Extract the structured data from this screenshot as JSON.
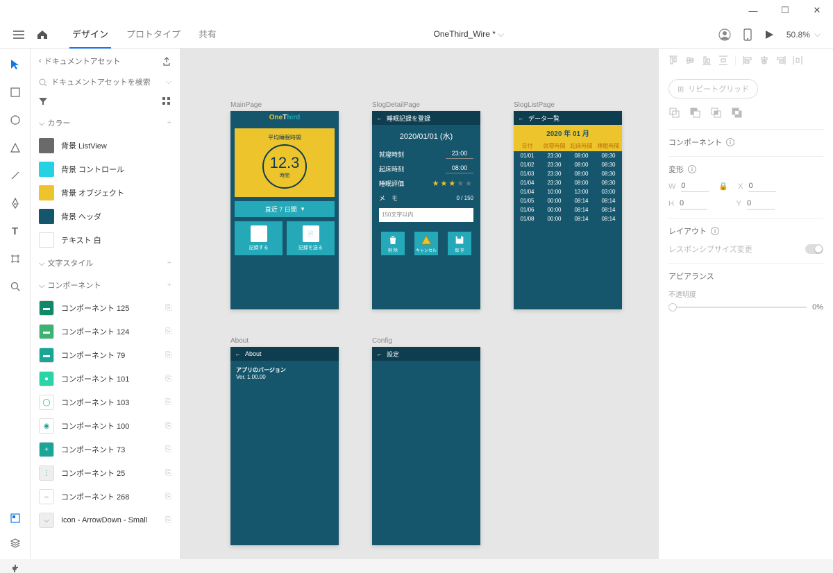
{
  "window": {
    "title": "OneThird_Wire *"
  },
  "toolbar": {
    "tabs": [
      "デザイン",
      "プロトタイプ",
      "共有"
    ],
    "zoom": "50.8%"
  },
  "assets": {
    "back": "ドキュメントアセット",
    "search_placeholder": "ドキュメントアセットを検索",
    "sections": {
      "colors": "カラー",
      "text": "文字スタイル",
      "components": "コンポーネント"
    },
    "colors": [
      {
        "hex": "#6a6a6a",
        "label": "背景 ListView"
      },
      {
        "hex": "#25d2e2",
        "label": "背景 コントロール"
      },
      {
        "hex": "#eec42d",
        "label": "背景 オブジェクト"
      },
      {
        "hex": "#16566c",
        "label": "背景 ヘッダ"
      },
      {
        "hex": "#ffffff",
        "label": "テキスト 白"
      }
    ],
    "components": [
      {
        "bg": "#0e8a6a",
        "label": "コンポーネント 125"
      },
      {
        "bg": "#3cb371",
        "label": "コンポーネント 124"
      },
      {
        "bg": "#1aa596",
        "label": "コンポーネント 79"
      },
      {
        "bg": "#2bd4a7",
        "label": "コンポーネント 101"
      },
      {
        "bg": "#ffffff",
        "label": "コンポーネント 103"
      },
      {
        "bg": "#ffffff",
        "label": "コンポーネント 100"
      },
      {
        "bg": "#1aa596",
        "label": "コンポーネント 73"
      },
      {
        "bg": "#eeeeee",
        "label": "コンポーネント 25"
      },
      {
        "bg": "#ffffff",
        "label": "コンポーネント 268"
      },
      {
        "bg": "#eeeeee",
        "label": "Icon - ArrowDown - Small"
      }
    ]
  },
  "artboards": {
    "main": {
      "label": "MainPage",
      "title": "平均睡眠時間",
      "value": "12.3",
      "unit": "時間",
      "period": "直近 7 日間",
      "btn1": "記録する",
      "btn2": "記録を送る",
      "logo": [
        "One",
        "T",
        "hird"
      ]
    },
    "sdetail": {
      "label": "SlogDetailPage",
      "header": "睡眠記録を登録",
      "date": "2020/01/01 (水)",
      "row1": {
        "l": "就寝時刻",
        "v": "23:00"
      },
      "row2": {
        "l": "起床時刻",
        "v": "08:00"
      },
      "row3": {
        "l": "睡眠評価"
      },
      "memo_l": "メ　モ",
      "memo_c": "0 / 150",
      "memo_p": "150文字以内",
      "act": [
        "削 除",
        "キャンセル",
        "保 存"
      ]
    },
    "slist": {
      "label": "SlogListPage",
      "header": "データ一覧",
      "month": "2020 年 01 月",
      "cols": [
        "日付",
        "就寝時間",
        "起床時間",
        "睡眠時間"
      ],
      "rows": [
        [
          "01/01",
          "23:30",
          "08:00",
          "08:30"
        ],
        [
          "01/02",
          "23:30",
          "08:00",
          "08:30"
        ],
        [
          "01/03",
          "23:30",
          "08:00",
          "08:30"
        ],
        [
          "01/04",
          "23:30",
          "08:00",
          "08:30"
        ],
        [
          "01/04",
          "10:00",
          "13:00",
          "03:00"
        ],
        [
          "01/05",
          "00:00",
          "08:14",
          "08:14"
        ],
        [
          "01/06",
          "00:00",
          "08:14",
          "08:14"
        ],
        [
          "01/08",
          "00:00",
          "08:14",
          "08:14"
        ]
      ]
    },
    "about": {
      "label": "About",
      "header": "About",
      "line1": "アプリのバージョン",
      "line2": "Ver. 1.00.00"
    },
    "config": {
      "label": "Config",
      "header": "設定"
    }
  },
  "rpanel": {
    "repeat": "リピートグリッド",
    "component": "コンポーネント",
    "transform": "変形",
    "w": "0",
    "x": "0",
    "h": "0",
    "y": "0",
    "layout": "レイアウト",
    "responsive": "レスポンシブサイズ変更",
    "appearance": "アピアランス",
    "opacity": "不透明度",
    "opacity_val": "0%"
  }
}
